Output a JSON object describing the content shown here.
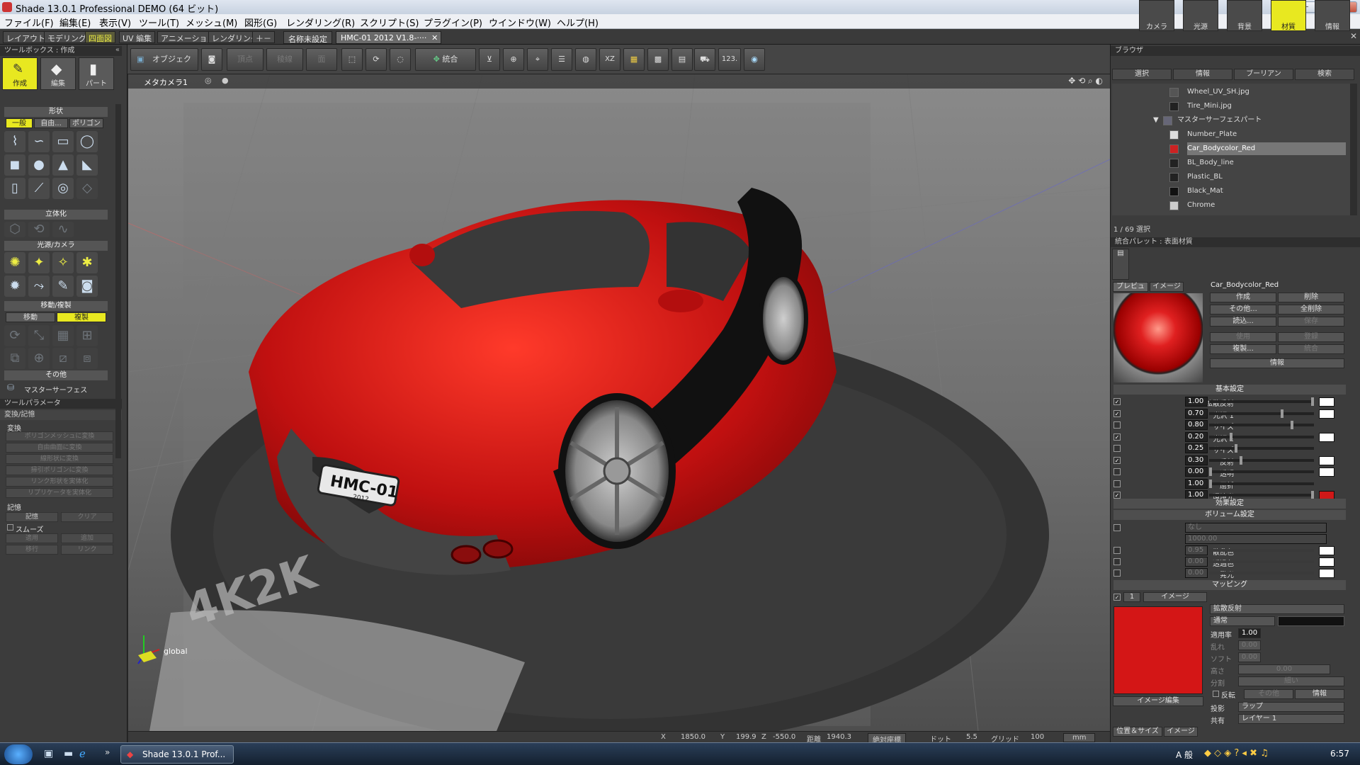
{
  "window": {
    "title": "Shade 13.0.1 Professional DEMO (64 ビット)"
  },
  "menu": [
    "ファイル(F)",
    "編集(E)",
    "表示(V)",
    "ツール(T)",
    "メッシュ(M)",
    "図形(G)",
    "レンダリング(R)",
    "スクリプト(S)",
    "プラグイン(P)",
    "ウインドウ(W)",
    "ヘルプ(H)"
  ],
  "layout_tabs": [
    "レイアウト",
    "モデリング",
    "四面図",
    "UV 編集",
    "アニメーション",
    "レンダリング",
    "＋－"
  ],
  "doc_tabs": [
    "名称未設定",
    "HMC-01 2012 V1.8-····"
  ],
  "toolbar": {
    "object_label": "オブジェクト",
    "point_label": "頂点",
    "edge_label": "稜線",
    "face_label": "面",
    "merge_label": "統合",
    "xz_label": "XZ",
    "num_label": "123."
  },
  "left": {
    "toolbox_title": "ツールボックス : 作成",
    "modes": [
      "作成",
      "編集",
      "パート"
    ],
    "shape_header": "形状",
    "shape_tabs": [
      "一般",
      "自由...",
      "ポリゴン"
    ],
    "solid_header": "立体化",
    "light_header": "光源/カメラ",
    "move_header": "移動/複製",
    "move_tabs": [
      "移動",
      "複製"
    ],
    "other_header": "その他",
    "master_surface": "マスターサーフェス",
    "params_title": "ツールパラメータ",
    "convert_title": "変換/記憶",
    "convert_label": "変換",
    "convert_buttons": [
      "ポリゴンメッシュに変換",
      "自由曲面に変換",
      "線形状に変換",
      "掃引ポリゴンに変換",
      "リンク形状を実体化",
      "リプリケータを実体化"
    ],
    "memory_label": "記憶",
    "memory_buttons": [
      "記憶",
      "クリア"
    ],
    "smooth_label": "スムーズ",
    "smooth_buttons": [
      "適用",
      "追加",
      "移行",
      "リンク"
    ]
  },
  "viewport": {
    "camera_label": "メタカメラ1",
    "axis_label": "global",
    "plate_text": "HMC-01",
    "plate_sub": "2012",
    "watermark": "4K2K"
  },
  "status": {
    "x_label": "X",
    "x_value": "1850.0",
    "y_label": "Y",
    "y_value": "199.9",
    "z_label": "Z",
    "z_value": "-550.0",
    "dist_label": "距離",
    "dist_value": "1940.3",
    "mode": "絶対座標",
    "dot_label": "ドット",
    "dot_value": "5.5",
    "grid_label": "グリッド",
    "grid_value": "100",
    "unit": "mm"
  },
  "browser": {
    "title": "ブラウザ",
    "tabs": [
      "選択",
      "情報",
      "ブーリアン",
      "検索"
    ],
    "items": [
      "Wheel_UV_SH.jpg",
      "Tire_Mini.jpg",
      "マスターサーフェスパート",
      "Number_Plate",
      "Car_Bodycolor_Red",
      "BL_Body_line",
      "Plastic_BL",
      "Black_Mat",
      "Chrome"
    ],
    "selection_info": "1 / 69 選択"
  },
  "palette": {
    "title": "統合パレット : 表面材質",
    "tabs": [
      "カメラ",
      "光源",
      "背景",
      "材質",
      "情報"
    ],
    "preview_tabs": [
      "プレビュー",
      "イメージ"
    ],
    "material_name": "Car_Bodycolor_Red",
    "buttons": [
      "作成",
      "削除",
      "その他...",
      "全削除",
      "読込...",
      "保存",
      "使用",
      "登録",
      "複製...",
      "統合",
      "情報"
    ],
    "basic_header": "基本設定",
    "props": [
      {
        "label": "拡散反射",
        "value": "1.00",
        "checked": "✓",
        "fill": 1.0,
        "color": "#ffffff"
      },
      {
        "label": "光沢 1",
        "value": "0.70",
        "checked": "✓",
        "fill": 0.7,
        "color": "#ffffff"
      },
      {
        "label": "サイズ",
        "value": "0.80",
        "checked": "",
        "fill": 0.8,
        "color": ""
      },
      {
        "label": "光沢 2",
        "value": "0.20",
        "checked": "✓",
        "fill": 0.2,
        "color": "#ffffff"
      },
      {
        "label": "サイズ",
        "value": "0.25",
        "checked": "",
        "fill": 0.25,
        "color": ""
      },
      {
        "label": "反射",
        "value": "0.30",
        "checked": "✓",
        "fill": 0.3,
        "color": "#ffffff"
      },
      {
        "label": "透明",
        "value": "0.00",
        "checked": "",
        "fill": 0.0,
        "color": "#ffffff"
      },
      {
        "label": "屈折",
        "value": "1.00",
        "checked": "",
        "fill": 0.0,
        "color": ""
      },
      {
        "label": "環境光",
        "value": "1.00",
        "checked": "✓",
        "fill": 1.0,
        "color": "#d01818"
      }
    ],
    "effect_header": "効果設定",
    "volume_header": "ボリューム設定",
    "volume_rows": [
      {
        "label": "種類",
        "value": "なし"
      },
      {
        "label": "減衰距離",
        "value": "1000.00"
      },
      {
        "label": "散乱色",
        "value": "0.95"
      },
      {
        "label": "透過色",
        "value": "0.00"
      },
      {
        "label": "発光",
        "value": "0.00"
      }
    ],
    "mapping_header": "マッピング",
    "map_layer": "1",
    "map_type": "イメージ",
    "map_channel": "拡散反射",
    "map_blend": "通常",
    "apply_label": "適用率",
    "apply_value": "1.00",
    "blur_label": "乱れ",
    "blur_value": "0.00",
    "soft_label": "ソフト",
    "soft_value": "0.00",
    "height_label": "高さ",
    "height_value": "0.00",
    "split_label": "分割",
    "split_value": "細い",
    "invert_label": "反転",
    "invert_btn": "その他",
    "info_btn": "情報",
    "image_edit": "イメージ編集",
    "projection_label": "投影",
    "projection_value": "ラップ",
    "shared_label": "共有",
    "shared_value": "レイヤー 1",
    "bottom_tabs": [
      "位置＆サイズ",
      "イメージ"
    ]
  },
  "taskbar": {
    "app": "Shade 13.0.1 Prof...",
    "time": "6:57",
    "ime": "A 般"
  }
}
